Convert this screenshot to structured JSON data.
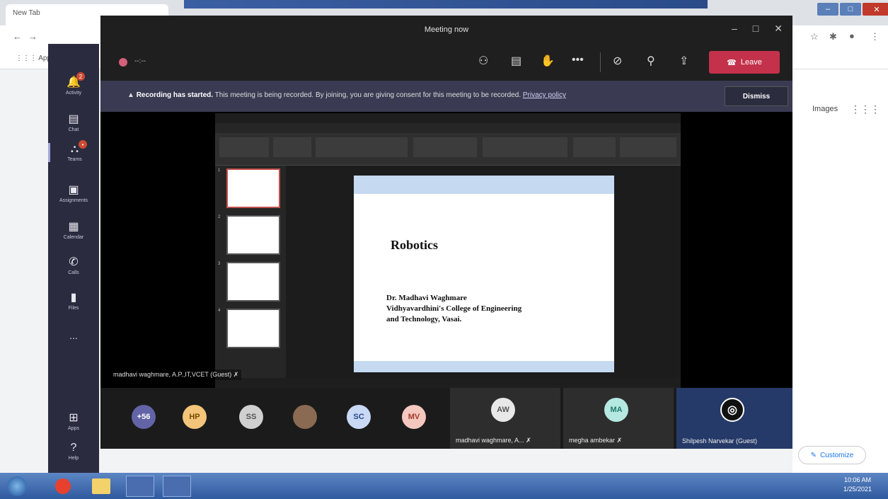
{
  "browser": {
    "tab_title": "New Tab",
    "bookmarks_apps": "Apps",
    "images_link": "Images",
    "customize_label": "Customize"
  },
  "teams_rail": {
    "items": [
      {
        "label": "Activity",
        "icon": "bell-icon",
        "badge": "2"
      },
      {
        "label": "Chat",
        "icon": "chat-icon",
        "badge": ""
      },
      {
        "label": "Teams",
        "icon": "teams-icon",
        "badge": "•"
      },
      {
        "label": "Assignments",
        "icon": "assignments-icon",
        "badge": ""
      },
      {
        "label": "Calendar",
        "icon": "calendar-icon",
        "badge": ""
      },
      {
        "label": "Calls",
        "icon": "phone-icon",
        "badge": ""
      },
      {
        "label": "Files",
        "icon": "file-icon",
        "badge": ""
      }
    ],
    "more": "...",
    "apps_label": "Apps",
    "help_label": "Help"
  },
  "meeting": {
    "title": "Meeting now",
    "timer": "--:--",
    "leave_label": "Leave",
    "banner": {
      "bold": "Recording has started.",
      "text": " This meeting is being recorded. By joining, you are giving consent for this meeting to be recorded. ",
      "link": "Privacy policy",
      "dismiss": "Dismiss"
    },
    "presenter_label": "madhavi waghmare, A.P.,IT,VCET (Guest)"
  },
  "slide": {
    "title": "Robotics",
    "author_line1": "Dr. Madhavi Waghmare",
    "author_line2": "Vidhyavardhini's College of Engineering",
    "author_line3": "and Technology, Vasai."
  },
  "participants": {
    "overflow": "+56",
    "avatars": [
      {
        "initials": "HP",
        "bg": "#f3c57a",
        "fg": "#7a4b00"
      },
      {
        "initials": "SS",
        "bg": "#d0d0d0",
        "fg": "#555555"
      },
      {
        "initials": "",
        "bg": "#8a6a52",
        "fg": "#ffffff"
      },
      {
        "initials": "SC",
        "bg": "#c8d8f5",
        "fg": "#2c4a8c"
      },
      {
        "initials": "MV",
        "bg": "#f4c7bf",
        "fg": "#a23a2a"
      }
    ],
    "tiles": [
      {
        "initials": "AW",
        "name": "madhavi waghmare, A...",
        "bg": "#e8e8e8",
        "fg": "#555555"
      },
      {
        "initials": "MA",
        "name": "megha ambekar",
        "bg": "#b5e8e0",
        "fg": "#1f7a6c"
      },
      {
        "initials": "",
        "name": "Shilpesh Narvekar (Guest)",
        "bg": "#ffffff",
        "fg": "#000000"
      }
    ]
  },
  "taskbar": {
    "time": "10:06 AM",
    "date": "1/25/2021"
  }
}
